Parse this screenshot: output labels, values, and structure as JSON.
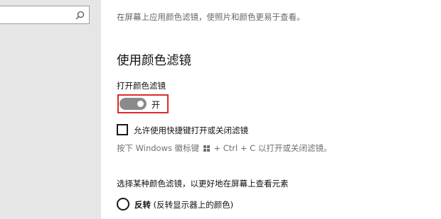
{
  "main": {
    "description": "在屏幕上应用颜色滤镜，使照片和颜色更易于查看。",
    "section_title": "使用颜色滤镜",
    "toggle": {
      "label": "打开颜色滤镜",
      "state": "开",
      "on": true
    },
    "shortcut_checkbox": {
      "label": "允许使用快捷键打开或关闭滤镜",
      "checked": false
    },
    "shortcut_hint": {
      "before": "按下 Windows 徽标键",
      "after": "+ Ctrl + C 以打开或关闭滤镜。"
    },
    "filter_prompt": "选择某种颜色滤镜，以更好地在屏幕上查看元素",
    "filter_options": [
      {
        "name": "反转",
        "detail": "(反转显示器上的颜色)"
      }
    ]
  },
  "colors": {
    "highlight": "#e02a2a",
    "toggle_track": "#8a8a8a",
    "sidebar_bg": "#e6e6e6"
  },
  "icons": {
    "search": "search-icon",
    "windows_logo": "windows-logo-icon"
  }
}
